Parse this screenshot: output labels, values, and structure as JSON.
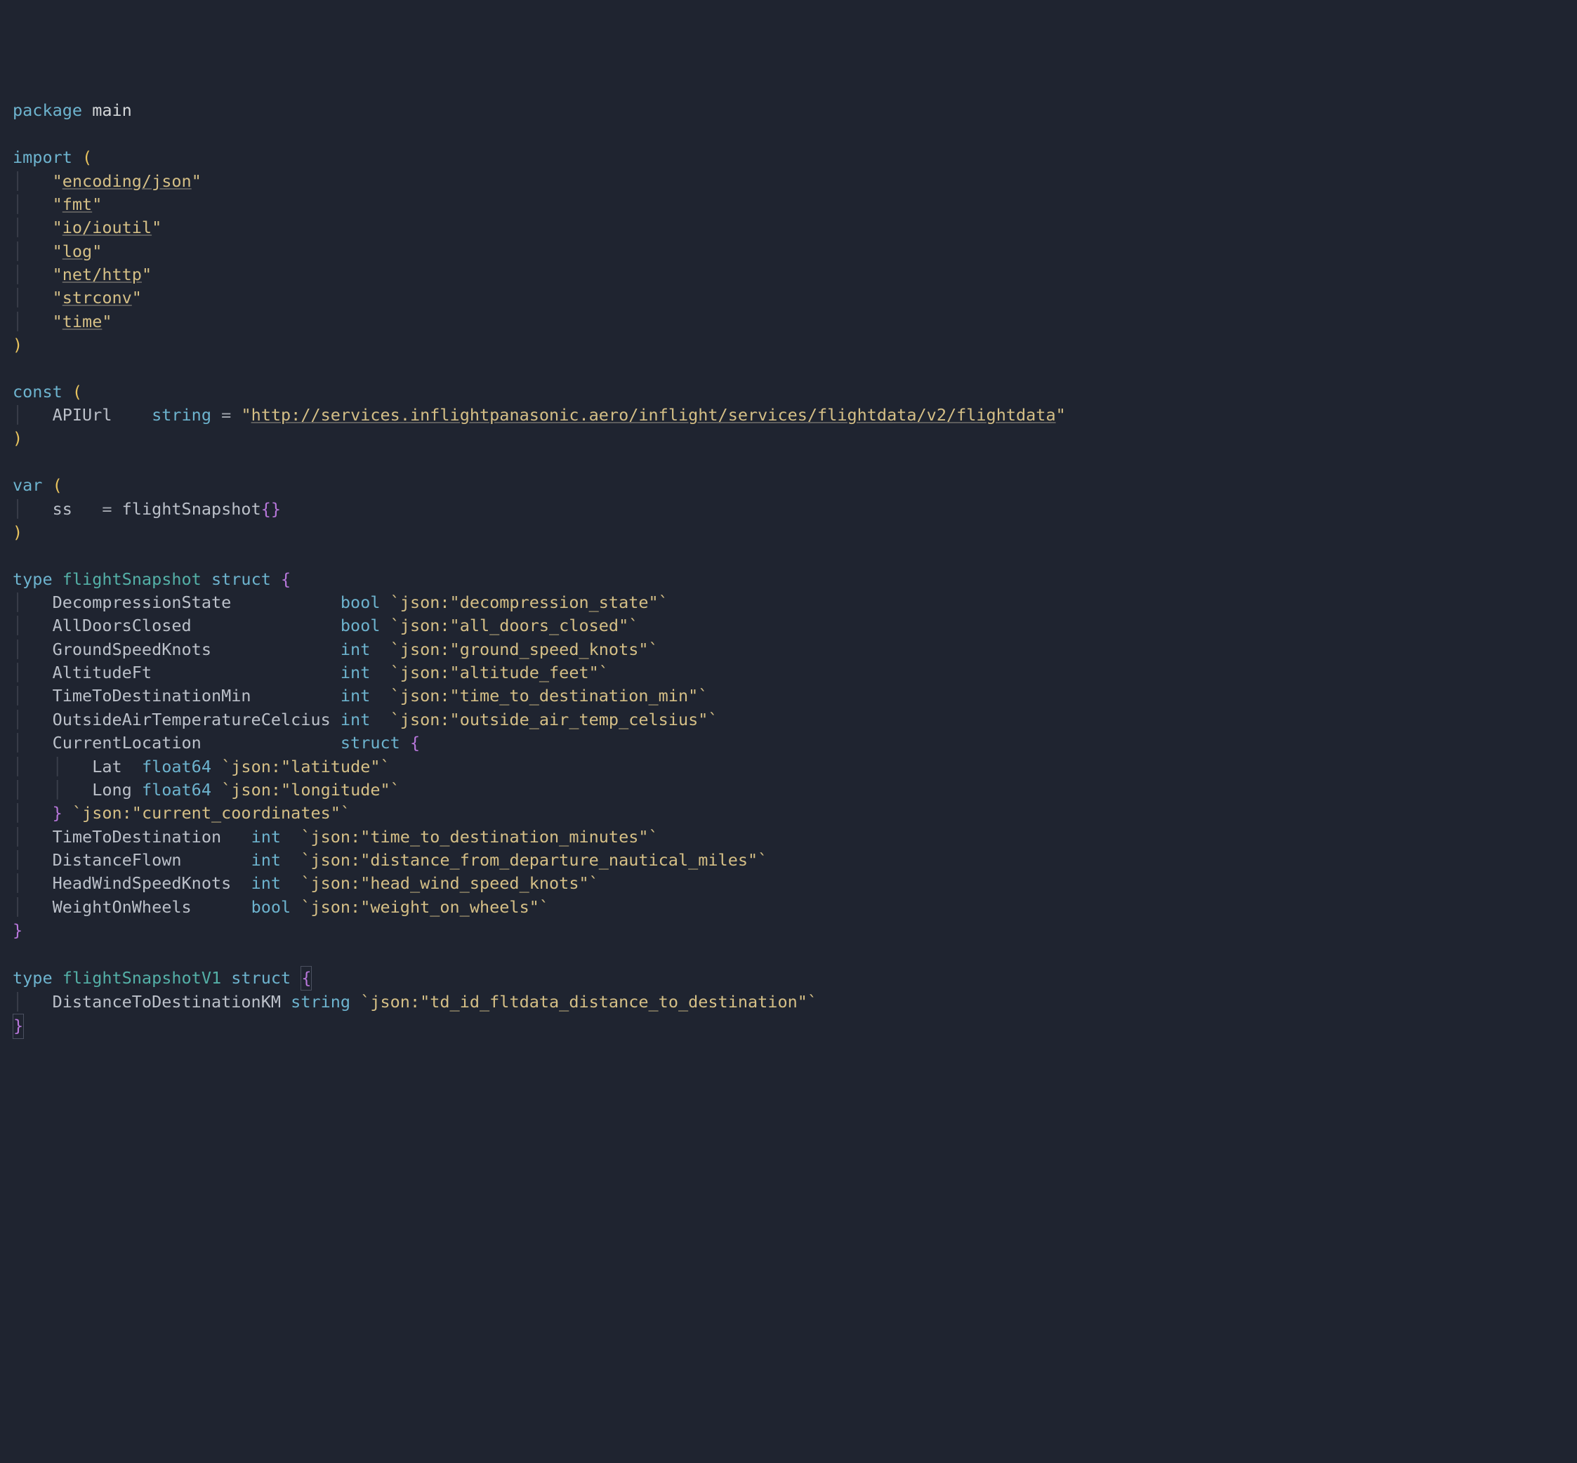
{
  "code": {
    "l1_package": "package",
    "l1_main": "main",
    "l3_import": "import",
    "imports": [
      "encoding/json",
      "fmt",
      "io/ioutil",
      "log",
      "net/http",
      "strconv",
      "time"
    ],
    "l12_const": "const",
    "const_name": "APIUrl",
    "const_type": "string",
    "const_eq": "=",
    "const_val": "http://services.inflightpanasonic.aero/inflight/services/flightdata/v2/flightdata",
    "l16_var": "var",
    "var_name": "ss",
    "var_eq": "=",
    "var_type": "flightSnapshot",
    "l20_type": "type",
    "l20_name": "flightSnapshot",
    "l20_struct": "struct",
    "fields1": [
      {
        "name": "DecompressionState",
        "pad": "          ",
        "type": "bool",
        "tag": "`json:\"decompression_state\"`"
      },
      {
        "name": "AllDoorsClosed",
        "pad": "              ",
        "type": "bool",
        "tag": "`json:\"all_doors_closed\"`"
      },
      {
        "name": "GroundSpeedKnots",
        "pad": "            ",
        "type": "int ",
        "tag": "`json:\"ground_speed_knots\"`"
      },
      {
        "name": "AltitudeFt",
        "pad": "                  ",
        "type": "int ",
        "tag": "`json:\"altitude_feet\"`"
      },
      {
        "name": "TimeToDestinationMin",
        "pad": "        ",
        "type": "int ",
        "tag": "`json:\"time_to_destination_min\"`"
      },
      {
        "name": "OutsideAirTemperatureCelcius",
        "pad": "",
        "type": "int ",
        "tag": "`json:\"outside_air_temp_celsius\"`"
      }
    ],
    "curloc_name": "CurrentLocation",
    "curloc_struct": "struct",
    "curloc_lat_name": "Lat",
    "curloc_lat_type": "float64",
    "curloc_lat_tag": "`json:\"latitude\"`",
    "curloc_long_name": "Long",
    "curloc_long_type": "float64",
    "curloc_long_tag": "`json:\"longitude\"`",
    "curloc_close_tag": "`json:\"current_coordinates\"`",
    "fields2": [
      {
        "name": "TimeToDestination",
        "pad": "  ",
        "type": "int ",
        "tag": "`json:\"time_to_destination_minutes\"`"
      },
      {
        "name": "DistanceFlown",
        "pad": "      ",
        "type": "int ",
        "tag": "`json:\"distance_from_departure_nautical_miles\"`"
      },
      {
        "name": "HeadWindSpeedKnots",
        "pad": " ",
        "type": "int ",
        "tag": "`json:\"head_wind_speed_knots\"`"
      },
      {
        "name": "WeightOnWheels",
        "pad": "     ",
        "type": "bool",
        "tag": "`json:\"weight_on_wheels\"`"
      }
    ],
    "l37_type": "type",
    "l37_name": "flightSnapshotV1",
    "l37_struct": "struct",
    "v1_field_name": "DistanceToDestinationKM",
    "v1_field_type": "string",
    "v1_field_tag": "`json:\"td_id_fltdata_distance_to_destination\"`"
  }
}
